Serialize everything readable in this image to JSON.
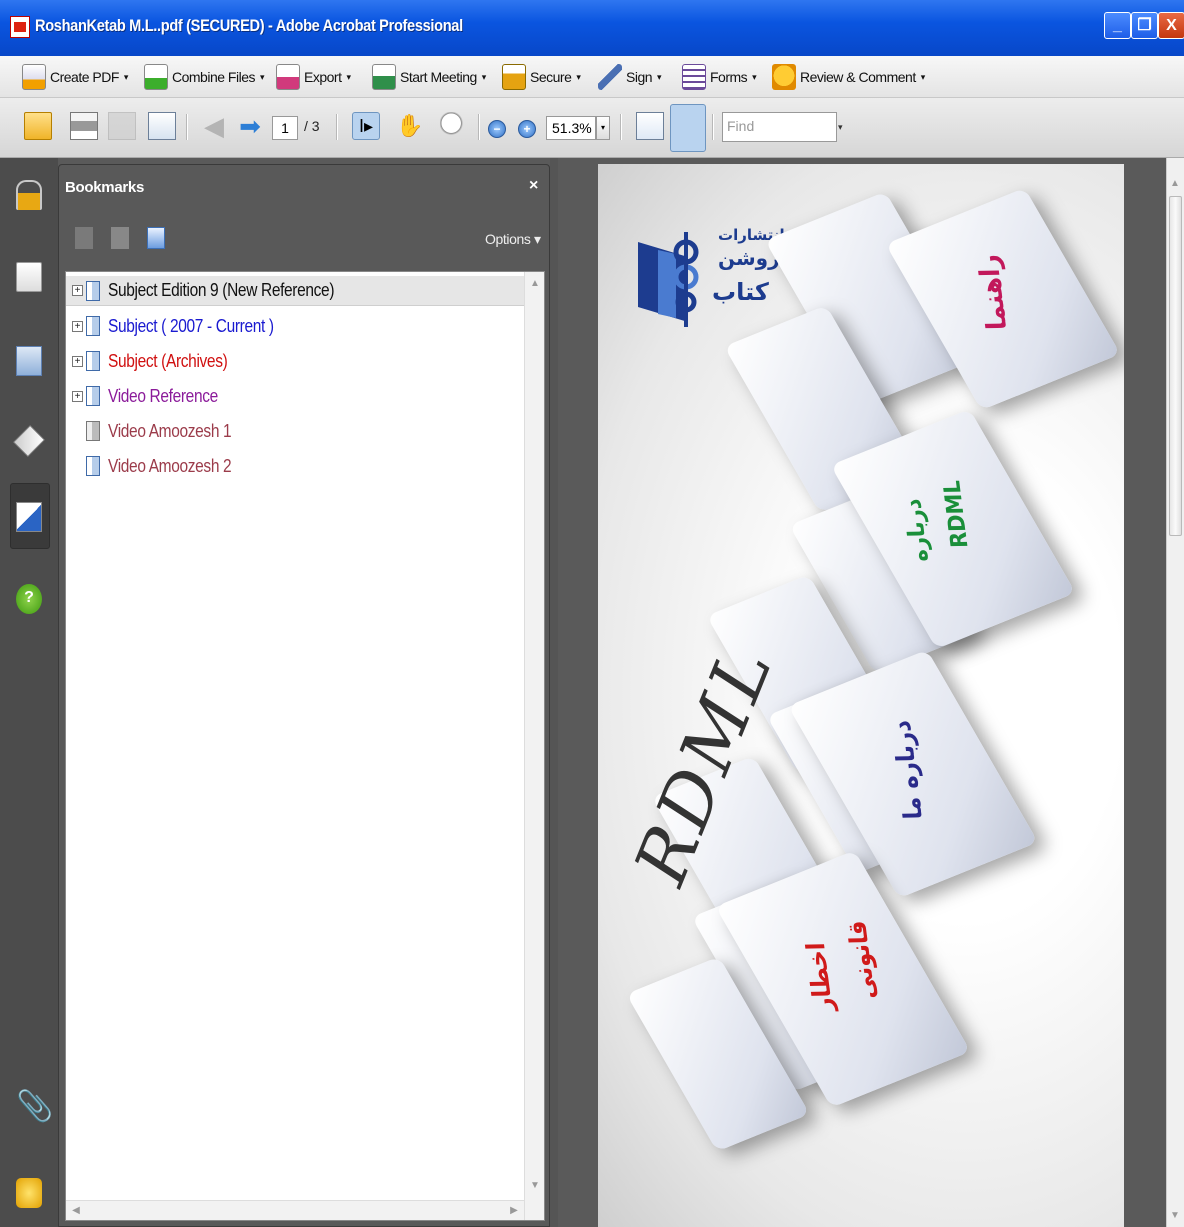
{
  "window": {
    "title": "RoshanKetab M.L..pdf (SECURED) - Adobe Acrobat Professional",
    "min_glyph": "_",
    "max_glyph": "❐",
    "close_glyph": "X"
  },
  "toolbar1": {
    "create_pdf": "Create PDF",
    "combine_files": "Combine Files",
    "export": "Export",
    "start_meeting": "Start Meeting",
    "secure": "Secure",
    "sign": "Sign",
    "forms": "Forms",
    "review_comment": "Review & Comment",
    "caret": "▾"
  },
  "toolbar2": {
    "current_page": "1",
    "total_pages": "/ 3",
    "zoom": "51.3%",
    "find_placeholder": "Find",
    "caret": "▾",
    "prev_glyph": "◀",
    "next_glyph": "➡",
    "zoom_out_glyph": "−",
    "zoom_in_glyph": "+",
    "select_glyph": "I▸",
    "hand_glyph": "✋"
  },
  "nav": {
    "help_glyph": "?",
    "clip_glyph": "📎"
  },
  "bookmarks": {
    "title": "Bookmarks",
    "close_glyph": "×",
    "options": "Options",
    "options_caret": "▾",
    "items": [
      {
        "label": "Subject Edition 9 (New Reference)",
        "color": "#111111",
        "expandable": true,
        "selected": true
      },
      {
        "label": "Subject  ( 2007 - Current )",
        "color": "#1a1ad0",
        "expandable": true,
        "selected": false
      },
      {
        "label": "Subject   (Archives)",
        "color": "#d01010",
        "expandable": true,
        "selected": false
      },
      {
        "label": "Video Reference",
        "color": "#8b1b9a",
        "expandable": true,
        "selected": false
      },
      {
        "label": "Video Amoozesh 1",
        "color": "#9b3b4a",
        "expandable": false,
        "selected": false
      },
      {
        "label": "Video Amoozesh 2",
        "color": "#9b3b4a",
        "expandable": false,
        "selected": false
      }
    ],
    "plus_glyph": "+"
  },
  "page_art": {
    "logo_line1": "انتشارات",
    "logo_line2": "روشن",
    "logo_line3": "کتاب",
    "cube1": "راهنما",
    "cube2_line1": "درباره",
    "cube2_line2": "RDML",
    "cube3": "درباره ما",
    "cube4_line1": "اخطار",
    "cube4_line2": "قانونی",
    "script": "RDML"
  },
  "colors": {
    "title_blue": "#0a55e0",
    "cube1_text": "#c2185b",
    "cube2_text": "#1a8f3a",
    "cube3_text": "#2a2a8a",
    "cube4_text": "#d01a1a"
  }
}
